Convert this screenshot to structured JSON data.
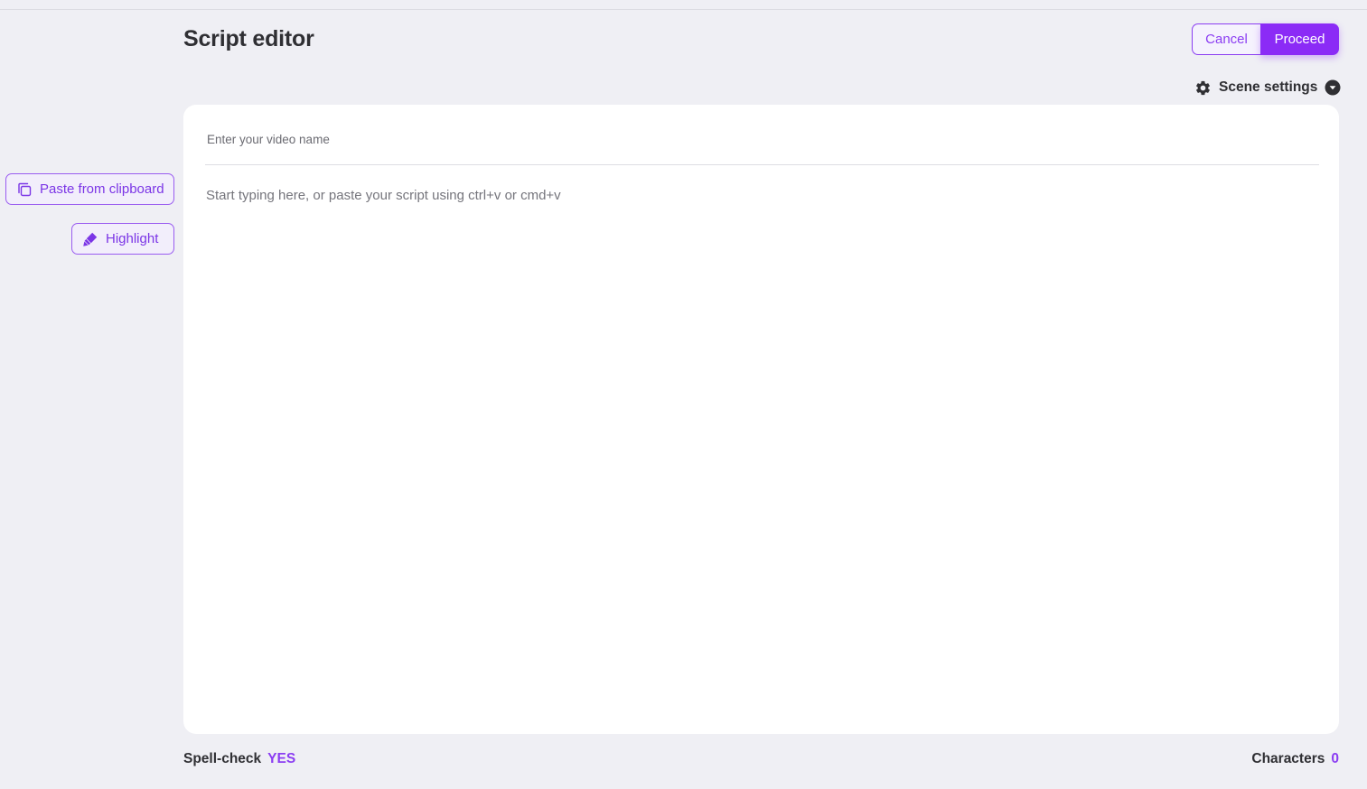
{
  "header": {
    "title": "Script editor",
    "cancel_label": "Cancel",
    "proceed_label": "Proceed"
  },
  "scene_settings": {
    "label": "Scene settings",
    "icon": "gear-icon",
    "caret_icon": "chevron-down-circle-icon"
  },
  "sidebar": {
    "paste_label": "Paste from clipboard",
    "paste_icon": "copy-icon",
    "highlight_label": "Highlight",
    "highlight_icon": "highlighter-icon"
  },
  "editor": {
    "video_name_value": "",
    "video_name_placeholder": "Enter your video name",
    "script_value": "",
    "script_placeholder": "Start typing here, or paste your script using ctrl+v or cmd+v"
  },
  "footer": {
    "spellcheck_label": "Spell-check",
    "spellcheck_value": "YES",
    "characters_label": "Characters",
    "characters_value": "0"
  },
  "colors": {
    "accent": "#8b2bf6",
    "accent_text": "#8b3df2",
    "background": "#efeff4",
    "card": "#ffffff",
    "text": "#2f2f33"
  }
}
